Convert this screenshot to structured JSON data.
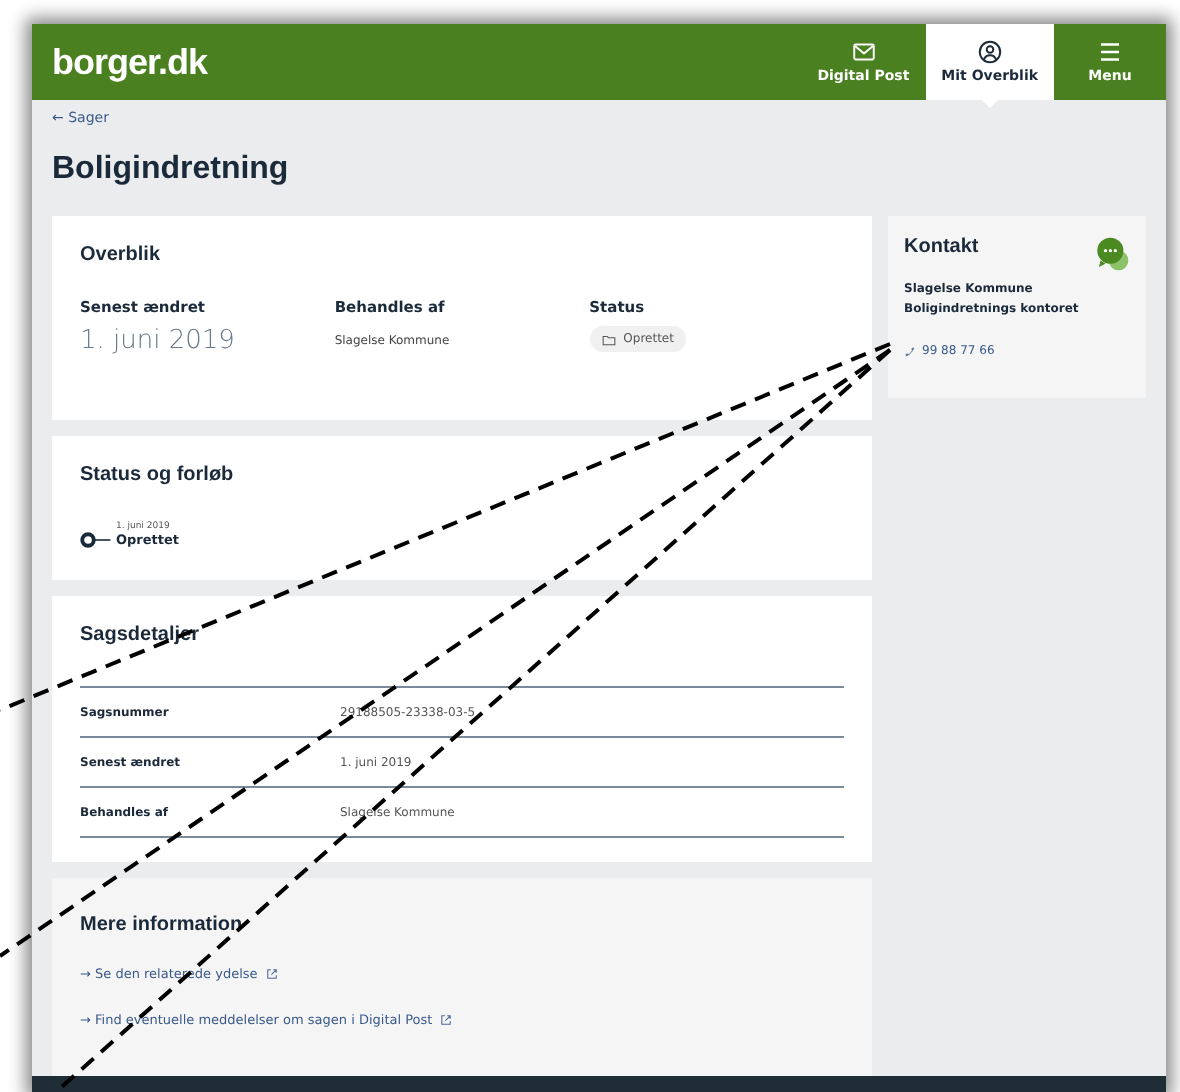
{
  "header": {
    "logo": "borger.dk",
    "nav": [
      {
        "label": "Digital Post",
        "kind": "mail",
        "selected": false
      },
      {
        "label": "Mit Overblik",
        "kind": "user",
        "selected": true
      },
      {
        "label": "Menu",
        "kind": "menu",
        "selected": false
      }
    ]
  },
  "breadcrumb": {
    "arrow": "←",
    "label": "Sager"
  },
  "title": "Boligindretning",
  "overview": {
    "title": "Overblik",
    "fields": [
      {
        "label": "Senest ændret",
        "value": "1. juni 2019",
        "kind": "large"
      },
      {
        "label": "Behandles af",
        "value": "Slagelse Kommune",
        "kind": "text"
      },
      {
        "label": "Status",
        "value": "Oprettet",
        "kind": "badge"
      }
    ]
  },
  "progress": {
    "title": "Status og forløb",
    "steps": [
      {
        "date": "1. juni 2019",
        "label": "Oprettet"
      }
    ]
  },
  "details": {
    "title": "Sagsdetaljer",
    "rows": [
      {
        "label": "Sagsnummer",
        "value": "29188505-23338-03-5"
      },
      {
        "label": "Senest ændret",
        "value": "1. juni 2019"
      },
      {
        "label": "Behandles af",
        "value": "Slagelse Kommune"
      }
    ]
  },
  "more_info": {
    "title": "Mere information",
    "links": [
      {
        "arrow": "→",
        "label": "Se den relaterede ydelse"
      },
      {
        "arrow": "→",
        "label": "Find eventuelle meddelelser om sagen i Digital Post"
      }
    ]
  },
  "contact": {
    "title": "Kontakt",
    "lines": [
      "Slagelse Kommune",
      "Boligindretnings kontoret"
    ],
    "phone": "99 88 77 66"
  }
}
